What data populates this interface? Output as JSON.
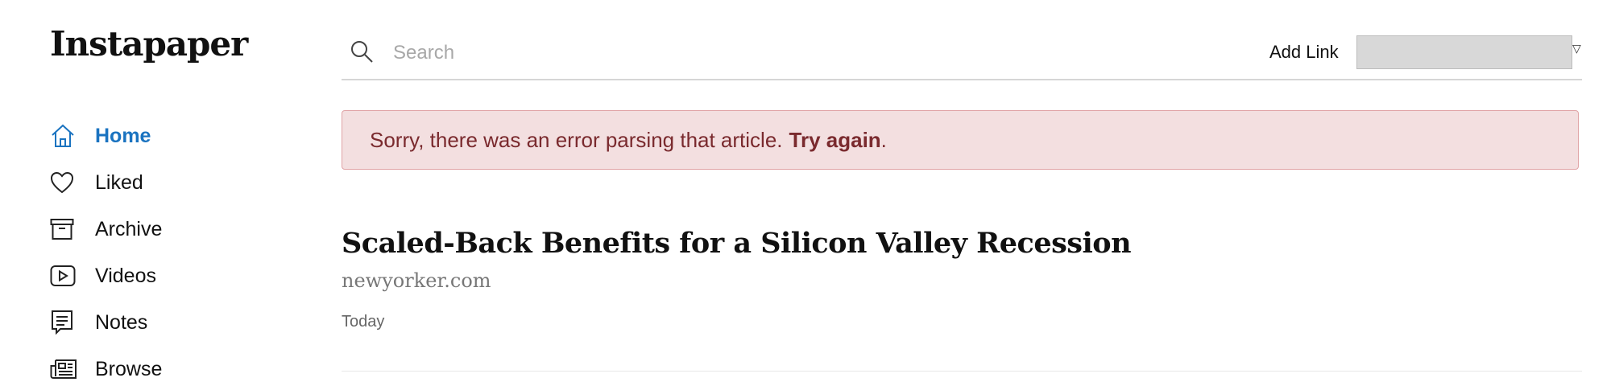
{
  "app": {
    "logo": "Instapaper"
  },
  "sidebar": {
    "items": [
      {
        "label": "Home",
        "icon": "home-icon",
        "active": true
      },
      {
        "label": "Liked",
        "icon": "heart-icon",
        "active": false
      },
      {
        "label": "Archive",
        "icon": "archive-icon",
        "active": false
      },
      {
        "label": "Videos",
        "icon": "video-icon",
        "active": false
      },
      {
        "label": "Notes",
        "icon": "notes-icon",
        "active": false
      },
      {
        "label": "Browse",
        "icon": "newspaper-icon",
        "active": false
      }
    ]
  },
  "search": {
    "placeholder": "Search",
    "value": ""
  },
  "add_link": {
    "label": "Add Link",
    "value": ""
  },
  "error": {
    "message": "Sorry, there was an error parsing that article.",
    "retry_label": "Try again",
    "suffix": "."
  },
  "article": {
    "title": "Scaled-Back Benefits for a Silicon Valley Recession",
    "domain": "newyorker.com",
    "date": "Today"
  },
  "colors": {
    "accent": "#1a73c0",
    "error_bg": "#f3dfe0",
    "error_text": "#7a2a2e",
    "error_border": "#e0a3a6"
  }
}
